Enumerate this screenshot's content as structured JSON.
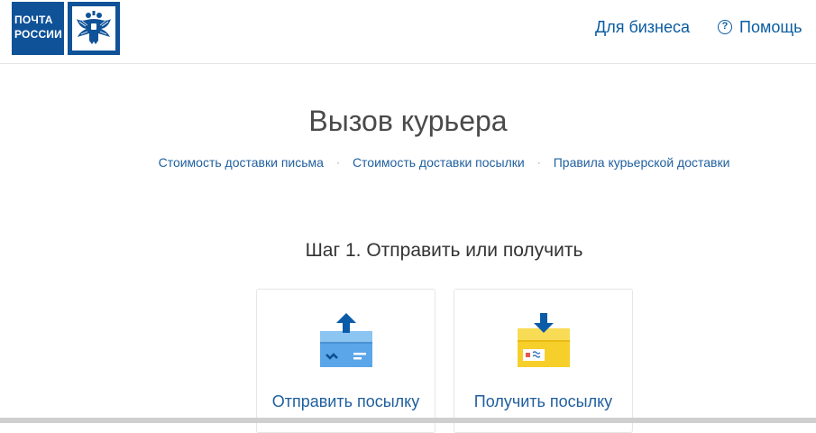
{
  "header": {
    "logo_line1": "ПОЧТА",
    "logo_line2": "РОССИИ",
    "nav_business": "Для бизнеса",
    "nav_help": "Помощь",
    "help_icon_glyph": "?"
  },
  "main": {
    "title": "Вызов курьера",
    "links": [
      "Стоимость доставки письма",
      "Стоимость доставки посылки",
      "Правила курьерской доставки"
    ],
    "separator": "·",
    "step_title": "Шаг 1. Отправить или получить",
    "options": [
      {
        "label": "Отправить посылку",
        "icon": "send-parcel-icon"
      },
      {
        "label": "Получить посылку",
        "icon": "receive-parcel-icon"
      }
    ]
  },
  "colors": {
    "brand_blue": "#0f5298",
    "link_blue": "#1f5f9e",
    "send_icon_blue": "#5aa6e8",
    "receive_icon_yellow": "#f6cf2a"
  }
}
